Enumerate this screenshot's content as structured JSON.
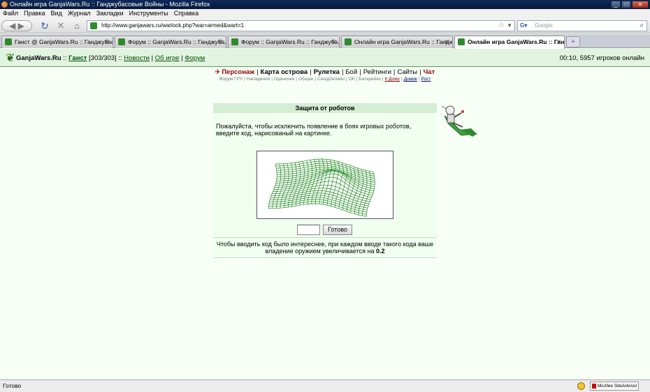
{
  "window": {
    "title": "Онлайн игра GanjaWars.Ru :: Ганджубасовые Войны - Mozilla Firefox"
  },
  "menu": [
    "Файл",
    "Правка",
    "Вид",
    "Журнал",
    "Закладки",
    "Инструменты",
    "Справка"
  ],
  "nav": {
    "url": "http://www.ganjawars.ru/warlock.php?war=armed&wart=1",
    "search_placeholder": "Google"
  },
  "tabs": [
    {
      "label": "Ганст @ GanjaWars.Ru :: Ганджубас..."
    },
    {
      "label": "Форум :: GanjaWars.Ru :: Ганджуба..."
    },
    {
      "label": "Форум :: GanjaWars.Ru :: Ганджуба..."
    },
    {
      "label": "Онлайн игра GanjaWars.Ru :: Гандж..."
    },
    {
      "label": "Онлайн игра GanjaWars.Ru :: Ган..."
    }
  ],
  "header": {
    "site": "GanjaWars.Ru",
    "sep1": "::",
    "user": "Ганст",
    "hp": "[303/303]",
    "sep2": "::",
    "links": [
      "Новости",
      "Об игре",
      "Форум"
    ],
    "status": "00:10, 5957 игроков онлайн"
  },
  "mainnav": [
    "Персонаж",
    "Карта острова",
    "Рулетка",
    "Бой",
    "Рейтинги",
    "Сайты",
    "Чат"
  ],
  "subnav": [
    "Форум ГРУ",
    "Нападения",
    "Одиночки",
    "Общие",
    "СиндОнлайн",
    "ОК",
    "Батарейки",
    "К Дому",
    "Домик",
    "Рост"
  ],
  "captcha_panel": {
    "title": "Защита от роботов",
    "message": "Пожалуйста, чтобы исключить появление в боях игровых роботов, введите код, нарисованый на картинке.",
    "button": "Готово",
    "note_text": "Чтобы вводить код было интереснее, при каждом вводе такого кода ваше владение оружием увеличивается на",
    "note_value": "0.2"
  },
  "status": {
    "text": "Готово",
    "addon": "McAfee SiteAdvisor"
  }
}
